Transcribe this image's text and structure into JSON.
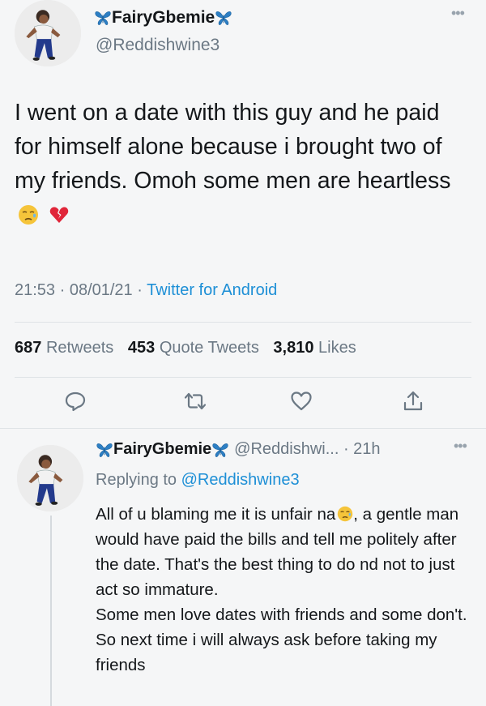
{
  "tweet": {
    "display_name": "FairyGbemie",
    "handle": "@Reddishwine3",
    "text": "I went on a date with this guy and he paid for himself alone because i brought two of my friends. Omoh some men are heartless",
    "timestamp": "21:53 · 08/01/21 · ",
    "client": "Twitter for Android",
    "stats": {
      "retweets_count": "687",
      "retweets_label": "Retweets",
      "quotes_count": "453",
      "quotes_label": "Quote Tweets",
      "likes_count": "3,810",
      "likes_label": "Likes"
    },
    "icons": [
      "butterfly-icon",
      "more-icon",
      "sad-face-emoji",
      "broken-heart-emoji",
      "reply-icon",
      "retweet-icon",
      "like-icon",
      "share-icon"
    ]
  },
  "reply": {
    "display_name": "FairyGbemie",
    "handle": "@Reddishwi... · 21h",
    "replying_prefix": "Replying to ",
    "replying_to": "@Reddishwine3",
    "text_part1": "All of u blaming me it is unfair na",
    "text_part2": ", a gentle man would have paid the bills and tell me politely after the date. That's the best thing to do nd not to just act so immature.\nSome men love dates with friends and some don't. So next time i will always ask before taking my friends"
  },
  "colors": {
    "link_blue": "#1d8fd6",
    "secondary_gray": "#6b7884",
    "butterfly_blue": "#2d7fc4"
  }
}
